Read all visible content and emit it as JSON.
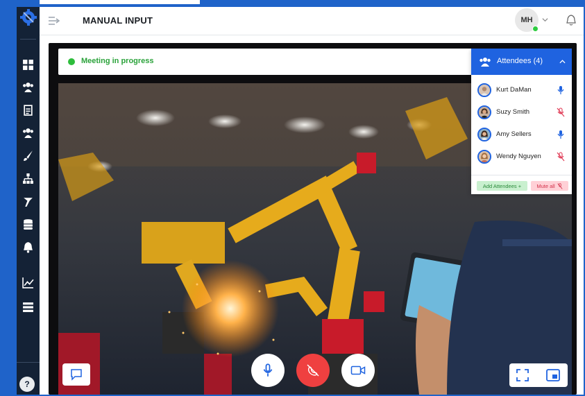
{
  "header": {
    "title": "MANUAL INPUT",
    "user_initials": "MH"
  },
  "sidebar": {
    "icons": [
      "dashboard-icon",
      "users-icon",
      "clipboard-icon",
      "team-icon",
      "brush-icon",
      "hierarchy-icon",
      "tools-icon",
      "database-icon",
      "bell-icon",
      "chart-icon",
      "server-icon"
    ],
    "help_label": "?"
  },
  "meeting": {
    "status_text": "Meeting in progress",
    "attendees_title": "Attendees (4)",
    "attendees": [
      {
        "name": "Kurt DaMan",
        "mic": "on"
      },
      {
        "name": "Suzy Smith",
        "mic": "muted"
      },
      {
        "name": "Amy Sellers",
        "mic": "on"
      },
      {
        "name": "Wendy Nguyen",
        "mic": "muted"
      }
    ],
    "add_label": "Add Attendees +",
    "mute_all_label": "Mute all"
  },
  "colors": {
    "accent": "#1f63e0",
    "status_green": "#2ebd3c",
    "hangup_red": "#ef4040",
    "sidebar_bg": "#142236"
  }
}
